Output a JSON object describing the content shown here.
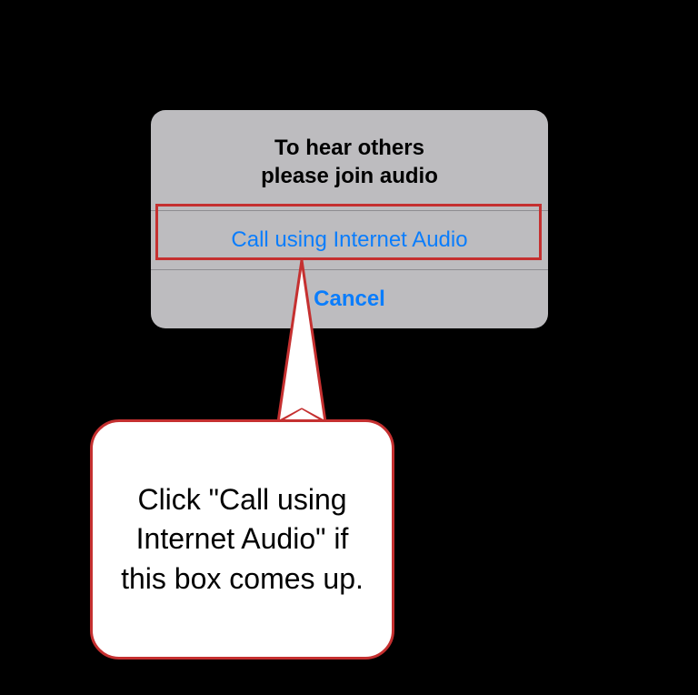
{
  "dialog": {
    "title": "To hear others\nplease join audio",
    "option_internet_audio": "Call using Internet Audio",
    "cancel": "Cancel"
  },
  "annotation": {
    "callout_text": "Click \"Call using Internet Audio\" if this box comes up.",
    "highlight_color": "#c53030"
  }
}
